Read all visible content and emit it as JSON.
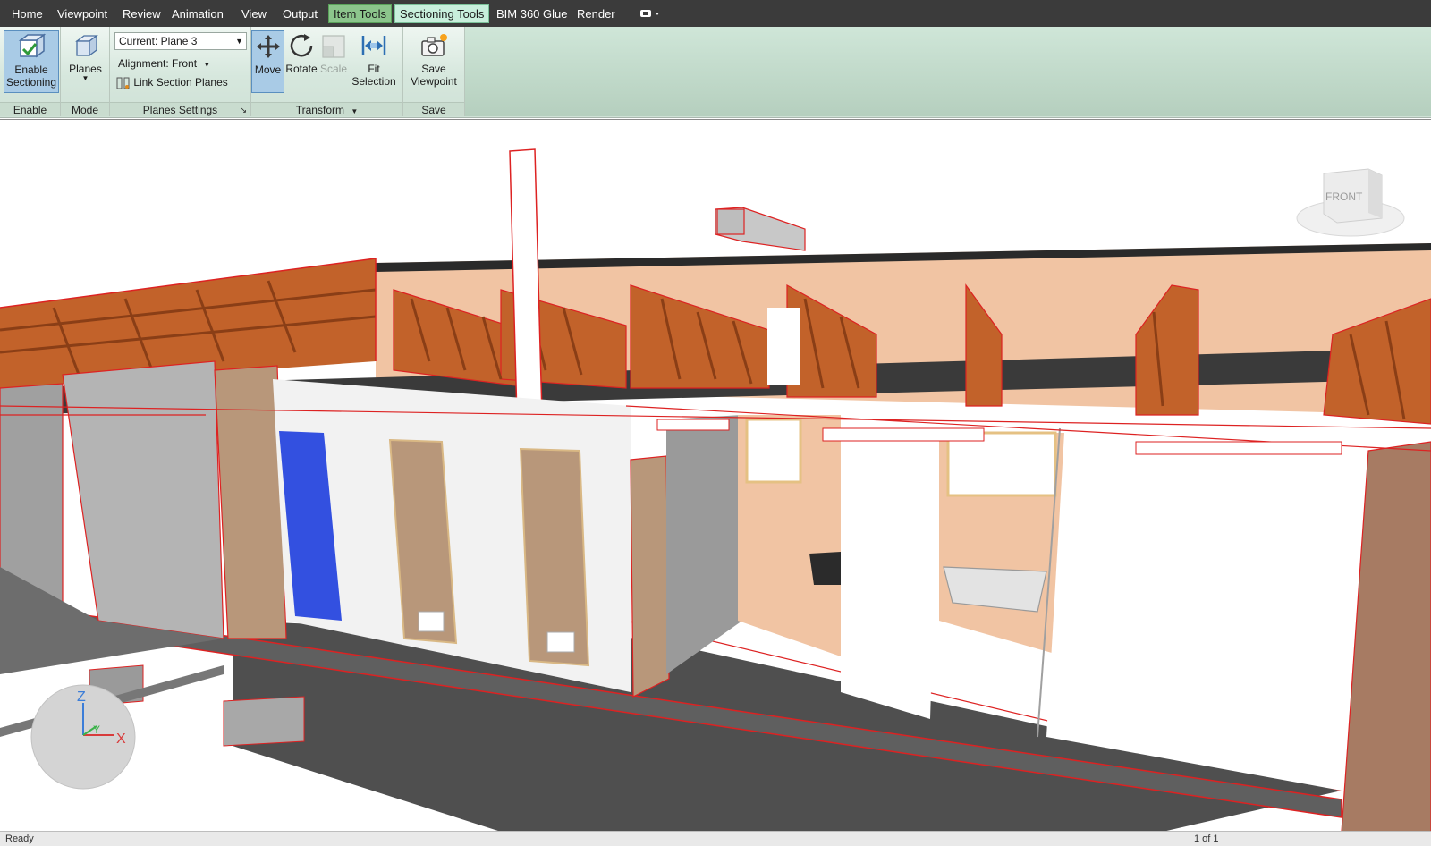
{
  "menu": {
    "tabs": [
      "Home",
      "Viewpoint",
      "Review",
      "Animation",
      "View",
      "Output",
      "Item Tools",
      "Sectioning Tools",
      "BIM 360 Glue",
      "Render"
    ]
  },
  "ribbon": {
    "enable": {
      "button_label": "Enable Sectioning",
      "group_label": "Enable"
    },
    "mode": {
      "button_label": "Planes",
      "group_label": "Mode"
    },
    "planes_settings": {
      "current_plane": "Current: Plane 3",
      "alignment": "Alignment: Front",
      "link_section_planes": "Link Section Planes",
      "group_label": "Planes Settings"
    },
    "transform": {
      "move": "Move",
      "rotate": "Rotate",
      "scale": "Scale",
      "fit_selection": "Fit Selection",
      "group_label": "Transform"
    },
    "save": {
      "button_label": "Save Viewpoint",
      "group_label": "Save"
    }
  },
  "viewcube": {
    "face": "FRONT"
  },
  "axis": {
    "z": "Z",
    "y": "Y",
    "x": "X"
  },
  "statusbar": {
    "left": "Ready",
    "page": "1 of 1"
  },
  "colors": {
    "accent_selection": "#dd2222",
    "truss": "#c2622a",
    "ceiling": "#f1c4a3",
    "door_selected": "#3350e0",
    "door": "#b8977a",
    "floor": "#4f4f4f",
    "context_tab": "#8cc58c"
  }
}
